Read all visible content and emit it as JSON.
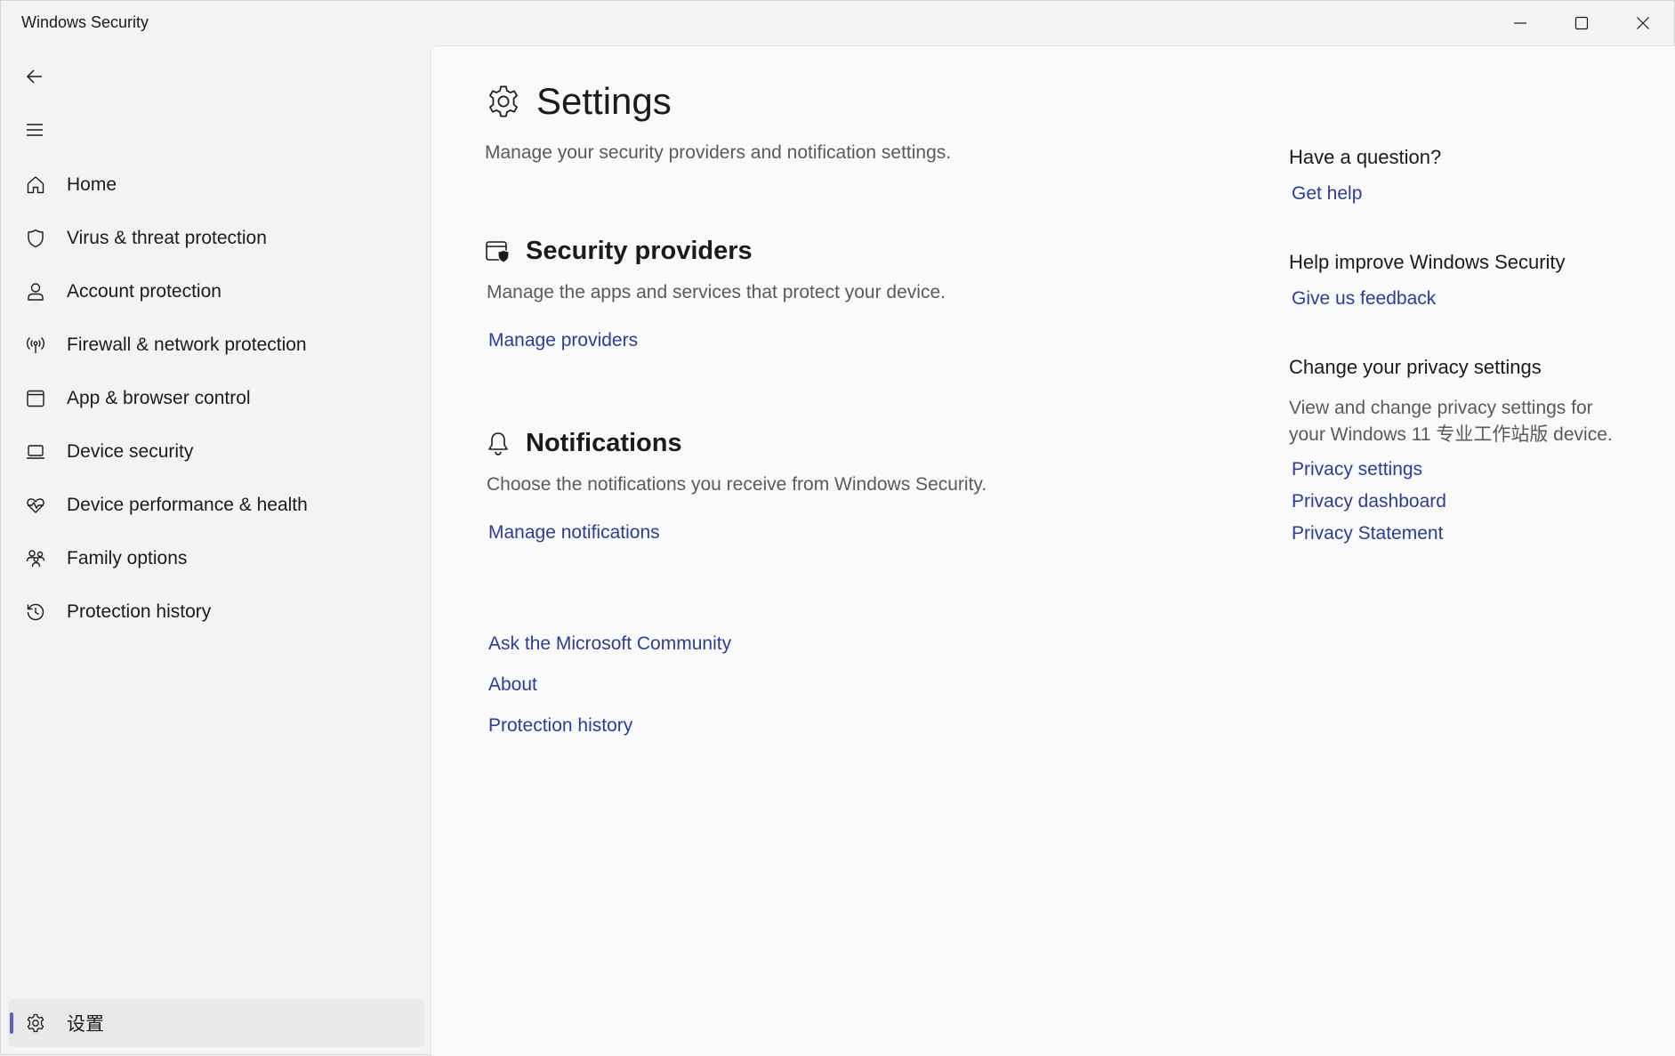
{
  "window": {
    "title": "Windows Security"
  },
  "sidebar": {
    "items": [
      {
        "label": "Home",
        "icon": "home-icon"
      },
      {
        "label": "Virus & threat protection",
        "icon": "shield-icon"
      },
      {
        "label": "Account protection",
        "icon": "person-icon"
      },
      {
        "label": "Firewall & network protection",
        "icon": "antenna-icon"
      },
      {
        "label": "App & browser control",
        "icon": "browser-window-icon"
      },
      {
        "label": "Device security",
        "icon": "laptop-icon"
      },
      {
        "label": "Device performance & health",
        "icon": "heart-pulse-icon"
      },
      {
        "label": "Family options",
        "icon": "family-icon"
      },
      {
        "label": "Protection history",
        "icon": "history-icon"
      }
    ],
    "settings_label": "设置"
  },
  "main": {
    "title": "Settings",
    "subtitle": "Manage your security providers and notification settings.",
    "providers": {
      "title": "Security providers",
      "desc": "Manage the apps and services that protect your device.",
      "link": "Manage providers"
    },
    "notifications": {
      "title": "Notifications",
      "desc": "Choose the notifications you receive from Windows Security.",
      "link": "Manage notifications"
    },
    "bottom_links": [
      "Ask the Microsoft Community",
      "About",
      "Protection history"
    ]
  },
  "aside": {
    "question": {
      "heading": "Have a question?",
      "link": "Get help"
    },
    "improve": {
      "heading": "Help improve Windows Security",
      "link": "Give us feedback"
    },
    "privacy": {
      "heading": "Change your privacy settings",
      "text": "View and change privacy settings for your Windows 11 专业工作站版 device.",
      "links": [
        "Privacy settings",
        "Privacy dashboard",
        "Privacy Statement"
      ]
    }
  },
  "colors": {
    "link": "#2b3d9a",
    "accent": "#5a5fcf"
  }
}
